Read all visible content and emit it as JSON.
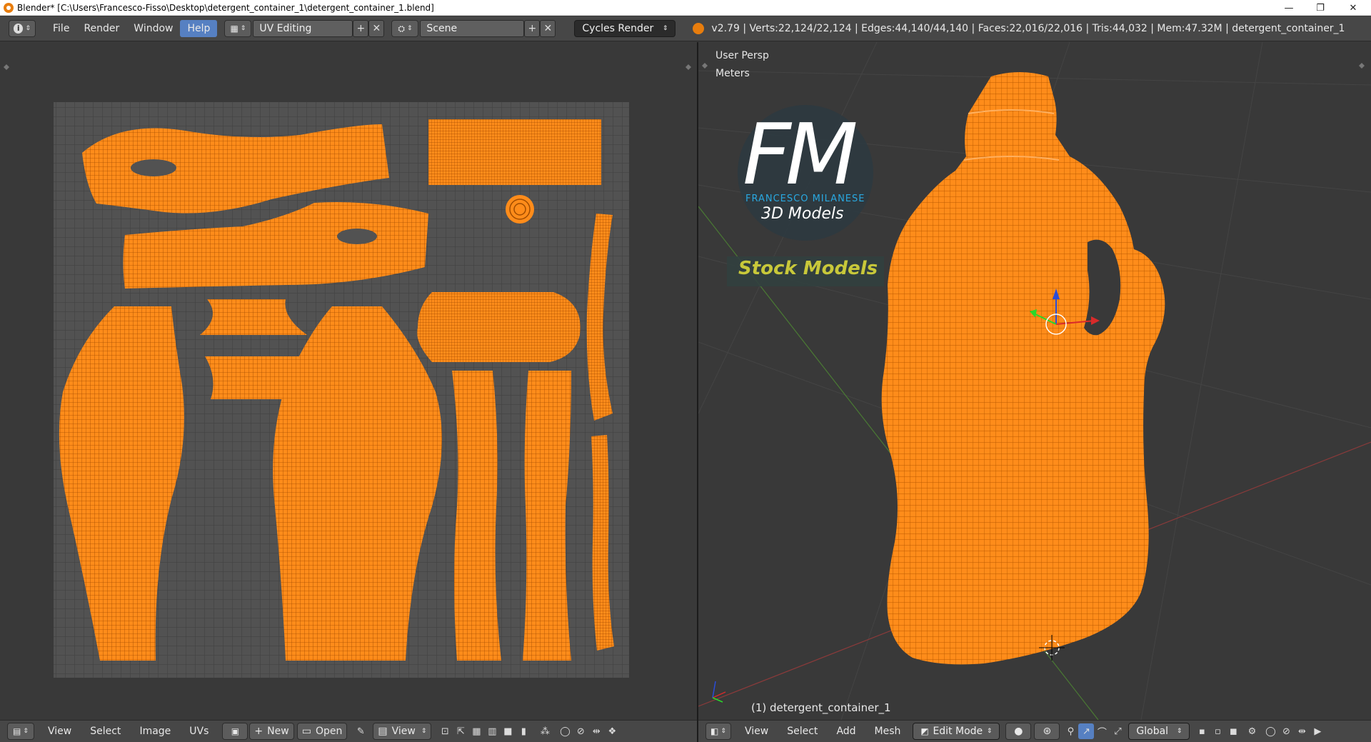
{
  "window": {
    "title": "Blender* [C:\\Users\\Francesco-Fisso\\Desktop\\detergent_container_1\\detergent_container_1.blend]",
    "minimize": "—",
    "restore": "❐",
    "close": "✕"
  },
  "infobar": {
    "menus": [
      "File",
      "Render",
      "Window",
      "Help"
    ],
    "layout_name": "UV Editing",
    "scene_name": "Scene",
    "render_engine": "Cycles Render",
    "stats": "v2.79 | Verts:22,124/22,124 | Edges:44,140/44,140 | Faces:22,016/22,016 | Tris:44,032 | Mem:47.32M | detergent_container_1"
  },
  "viewport": {
    "view_name": "User Persp",
    "units": "Meters",
    "object_label": "(1) detergent_container_1"
  },
  "watermark": {
    "logo_letters": "FM",
    "author": "FRANCESCO MILANESE",
    "subtitle": "3D Models",
    "banner": "Stock Models"
  },
  "uv_editor_header": {
    "menus": [
      "View",
      "Select",
      "Image",
      "UVs"
    ],
    "new_label": "New",
    "open_label": "Open",
    "view_label": "View"
  },
  "view3d_header": {
    "menus": [
      "View",
      "Select",
      "Add",
      "Mesh"
    ],
    "mode": "Edit Mode",
    "orientation": "Global"
  },
  "colors": {
    "mesh": "#ff8c1a",
    "background": "#393939",
    "header": "#474747",
    "active_menu": "#5680c2",
    "banner_text": "#c8c83a",
    "logo_blue": "#29a8e0"
  }
}
